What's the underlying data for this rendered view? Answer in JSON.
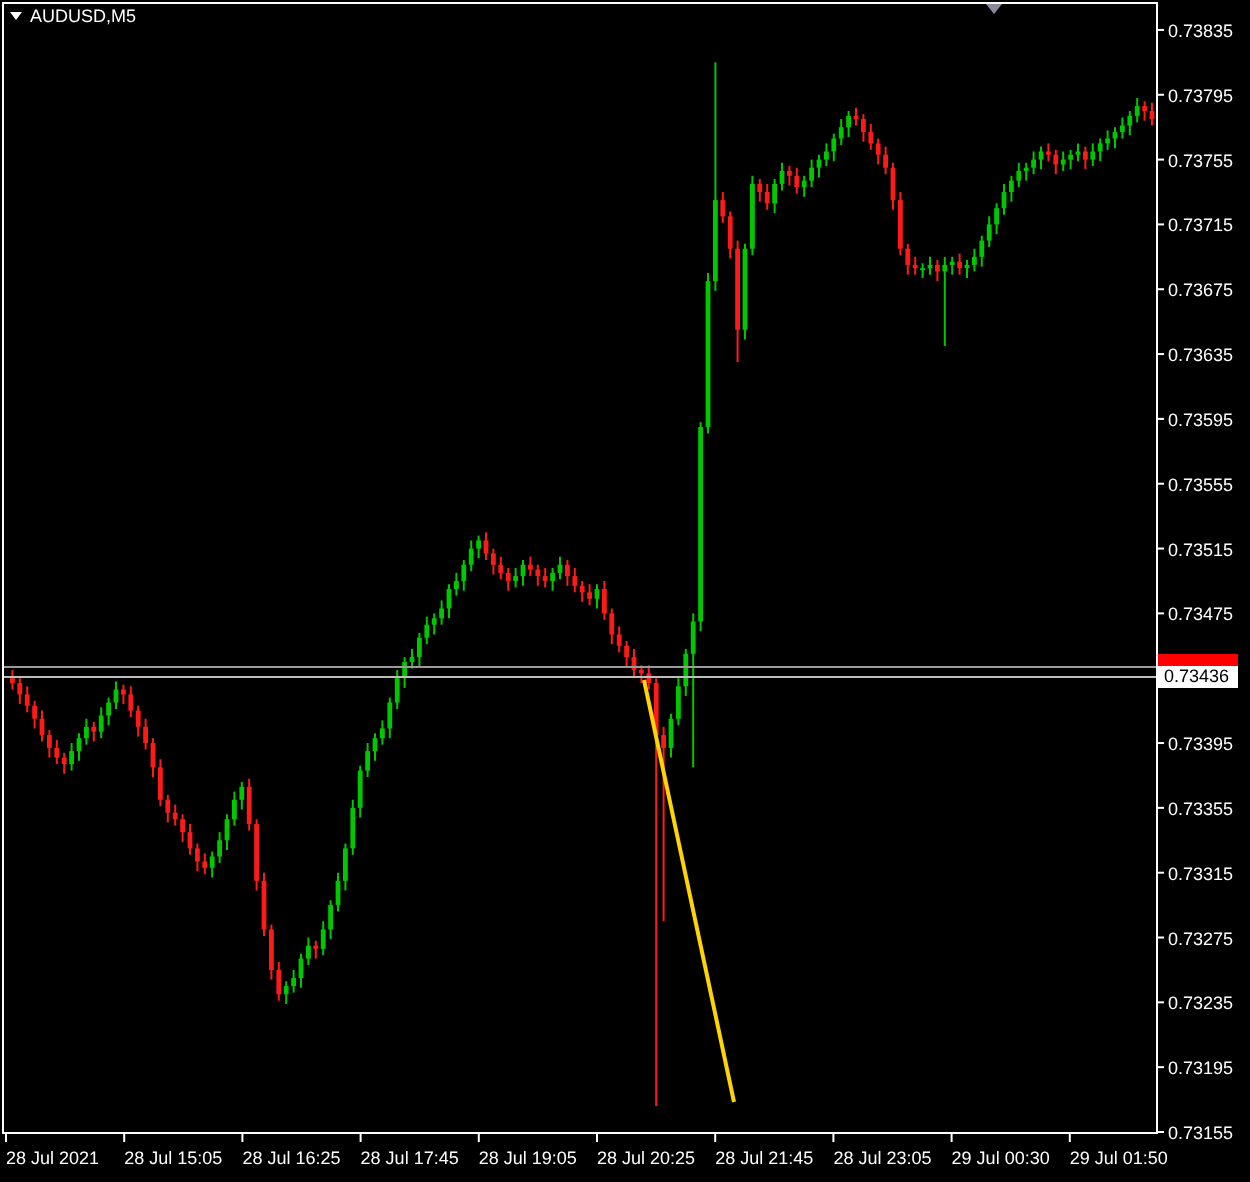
{
  "chart_title": "AUDUSD,M5",
  "chart_data": {
    "type": "candlestick",
    "yticks": [
      {
        "value": 0.73835,
        "label": "0.73835"
      },
      {
        "value": 0.73795,
        "label": "0.73795"
      },
      {
        "value": 0.73755,
        "label": "0.73755"
      },
      {
        "value": 0.73715,
        "label": "0.73715"
      },
      {
        "value": 0.73675,
        "label": "0.73675"
      },
      {
        "value": 0.73635,
        "label": "0.73635"
      },
      {
        "value": 0.73595,
        "label": "0.73595"
      },
      {
        "value": 0.73555,
        "label": "0.73555"
      },
      {
        "value": 0.73515,
        "label": "0.73515"
      },
      {
        "value": 0.73475,
        "label": "0.73475"
      },
      {
        "value": 0.73395,
        "label": "0.73395"
      },
      {
        "value": 0.73355,
        "label": "0.73355"
      },
      {
        "value": 0.73315,
        "label": "0.73315"
      },
      {
        "value": 0.73275,
        "label": "0.73275"
      },
      {
        "value": 0.73235,
        "label": "0.73235"
      },
      {
        "value": 0.73195,
        "label": "0.73195"
      },
      {
        "value": 0.73155,
        "label": "0.73155"
      }
    ],
    "ylim": [
      0.73155,
      0.73851
    ],
    "ref_lines": [
      {
        "axis": "y",
        "value": 0.73443,
        "color": "#9a9a9a"
      },
      {
        "axis": "y",
        "value": 0.73436,
        "color": "#bdbdbd"
      }
    ],
    "ohlc": [
      [
        0.73435,
        0.7344,
        0.73428,
        0.73432
      ],
      [
        0.73432,
        0.73435,
        0.73419,
        0.73425
      ],
      [
        0.73425,
        0.7343,
        0.73414,
        0.73418
      ],
      [
        0.73418,
        0.73421,
        0.73404,
        0.7341
      ],
      [
        0.7341,
        0.73415,
        0.73396,
        0.734
      ],
      [
        0.734,
        0.73403,
        0.73386,
        0.73392
      ],
      [
        0.73392,
        0.73397,
        0.73382,
        0.73386
      ],
      [
        0.73386,
        0.73389,
        0.73376,
        0.73382
      ],
      [
        0.73382,
        0.73395,
        0.73378,
        0.7339
      ],
      [
        0.7339,
        0.73401,
        0.73384,
        0.73398
      ],
      [
        0.73398,
        0.7341,
        0.73394,
        0.73405
      ],
      [
        0.73405,
        0.73408,
        0.73396,
        0.73402
      ],
      [
        0.73402,
        0.73417,
        0.73398,
        0.73412
      ],
      [
        0.73412,
        0.73423,
        0.73406,
        0.7342
      ],
      [
        0.7342,
        0.73433,
        0.73416,
        0.73428
      ],
      [
        0.73428,
        0.73431,
        0.73419,
        0.73425
      ],
      [
        0.73425,
        0.7343,
        0.73411,
        0.73415
      ],
      [
        0.73415,
        0.73418,
        0.73399,
        0.73405
      ],
      [
        0.73405,
        0.7341,
        0.73391,
        0.73395
      ],
      [
        0.73395,
        0.73398,
        0.73374,
        0.7338
      ],
      [
        0.7338,
        0.73385,
        0.73356,
        0.7336
      ],
      [
        0.7336,
        0.73363,
        0.73346,
        0.73352
      ],
      [
        0.73352,
        0.73357,
        0.73344,
        0.73348
      ],
      [
        0.73348,
        0.73351,
        0.73334,
        0.7334
      ],
      [
        0.7334,
        0.73345,
        0.73326,
        0.7333
      ],
      [
        0.7333,
        0.73333,
        0.73316,
        0.73322
      ],
      [
        0.73322,
        0.73327,
        0.73314,
        0.73318
      ],
      [
        0.73318,
        0.73328,
        0.73312,
        0.73325
      ],
      [
        0.73325,
        0.7334,
        0.73321,
        0.73335
      ],
      [
        0.73335,
        0.73351,
        0.73329,
        0.73348
      ],
      [
        0.73348,
        0.73365,
        0.73344,
        0.7336
      ],
      [
        0.7336,
        0.73371,
        0.73354,
        0.73368
      ],
      [
        0.73368,
        0.73373,
        0.73341,
        0.73345
      ],
      [
        0.73345,
        0.73348,
        0.73304,
        0.7331
      ],
      [
        0.7331,
        0.73315,
        0.73276,
        0.7328
      ],
      [
        0.7328,
        0.73283,
        0.73249,
        0.73255
      ],
      [
        0.73255,
        0.7326,
        0.73236,
        0.7324
      ],
      [
        0.7324,
        0.73248,
        0.73234,
        0.73245
      ],
      [
        0.73245,
        0.73255,
        0.73241,
        0.7325
      ],
      [
        0.7325,
        0.73265,
        0.73244,
        0.73262
      ],
      [
        0.73262,
        0.73275,
        0.73258,
        0.7327
      ],
      [
        0.7327,
        0.73273,
        0.73262,
        0.73268
      ],
      [
        0.73268,
        0.73285,
        0.73264,
        0.7328
      ],
      [
        0.7328,
        0.73298,
        0.73274,
        0.73295
      ],
      [
        0.73295,
        0.73315,
        0.73291,
        0.7331
      ],
      [
        0.7331,
        0.73333,
        0.73304,
        0.7333
      ],
      [
        0.7333,
        0.7336,
        0.73326,
        0.73355
      ],
      [
        0.73355,
        0.73381,
        0.73349,
        0.73378
      ],
      [
        0.73378,
        0.73395,
        0.73374,
        0.7339
      ],
      [
        0.7339,
        0.73401,
        0.73384,
        0.73398
      ],
      [
        0.73398,
        0.73409,
        0.73394,
        0.73404
      ],
      [
        0.73404,
        0.73423,
        0.73398,
        0.7342
      ],
      [
        0.7342,
        0.7344,
        0.73416,
        0.73435
      ],
      [
        0.73435,
        0.73448,
        0.73429,
        0.73445
      ],
      [
        0.73445,
        0.73453,
        0.73441,
        0.73448
      ],
      [
        0.73448,
        0.73463,
        0.73442,
        0.7346
      ],
      [
        0.7346,
        0.73473,
        0.73456,
        0.73468
      ],
      [
        0.73468,
        0.73475,
        0.73462,
        0.73472
      ],
      [
        0.73472,
        0.73483,
        0.73468,
        0.73478
      ],
      [
        0.73478,
        0.73493,
        0.73472,
        0.7349
      ],
      [
        0.7349,
        0.735,
        0.73486,
        0.73495
      ],
      [
        0.73495,
        0.73508,
        0.73489,
        0.73505
      ],
      [
        0.73505,
        0.7352,
        0.73501,
        0.73515
      ],
      [
        0.73515,
        0.73523,
        0.73509,
        0.7352
      ],
      [
        0.7352,
        0.73525,
        0.73508,
        0.73512
      ],
      [
        0.73512,
        0.73515,
        0.73499,
        0.73505
      ],
      [
        0.73505,
        0.7351,
        0.73496,
        0.735
      ],
      [
        0.735,
        0.73503,
        0.73489,
        0.73495
      ],
      [
        0.73495,
        0.73503,
        0.73491,
        0.73498
      ],
      [
        0.73498,
        0.73508,
        0.73492,
        0.73505
      ],
      [
        0.73505,
        0.7351,
        0.73498,
        0.73502
      ],
      [
        0.73502,
        0.73505,
        0.73492,
        0.73498
      ],
      [
        0.73498,
        0.73503,
        0.73491,
        0.73495
      ],
      [
        0.73495,
        0.73503,
        0.73489,
        0.735
      ],
      [
        0.735,
        0.7351,
        0.73496,
        0.73505
      ],
      [
        0.73505,
        0.73508,
        0.73492,
        0.73498
      ],
      [
        0.73498,
        0.73503,
        0.73488,
        0.73492
      ],
      [
        0.73492,
        0.73495,
        0.73482,
        0.73488
      ],
      [
        0.73488,
        0.73493,
        0.7348,
        0.73484
      ],
      [
        0.73484,
        0.73493,
        0.73478,
        0.7349
      ],
      [
        0.7349,
        0.73495,
        0.73471,
        0.73475
      ],
      [
        0.73475,
        0.73478,
        0.73456,
        0.73462
      ],
      [
        0.73462,
        0.73467,
        0.73451,
        0.73455
      ],
      [
        0.73455,
        0.73458,
        0.73442,
        0.73448
      ],
      [
        0.73448,
        0.73453,
        0.73436,
        0.7344
      ],
      [
        0.7344,
        0.73443,
        0.73432,
        0.73438
      ],
      [
        0.73438,
        0.73443,
        0.73428,
        0.73432
      ],
      [
        0.73432,
        0.73435,
        0.73171,
        0.734
      ],
      [
        0.734,
        0.73405,
        0.73285,
        0.73392
      ],
      [
        0.73392,
        0.73413,
        0.73386,
        0.7341
      ],
      [
        0.7341,
        0.73435,
        0.73406,
        0.7343
      ],
      [
        0.7343,
        0.73453,
        0.73424,
        0.7345
      ],
      [
        0.7345,
        0.73475,
        0.7338,
        0.7347
      ],
      [
        0.7347,
        0.73593,
        0.73464,
        0.7359
      ],
      [
        0.7359,
        0.73685,
        0.73586,
        0.7368
      ],
      [
        0.7368,
        0.73815,
        0.73674,
        0.7373
      ],
      [
        0.7373,
        0.73735,
        0.73716,
        0.7372
      ],
      [
        0.7372,
        0.73723,
        0.73694,
        0.737
      ],
      [
        0.737,
        0.73705,
        0.7363,
        0.7365
      ],
      [
        0.7365,
        0.73703,
        0.73644,
        0.737
      ],
      [
        0.737,
        0.73745,
        0.73696,
        0.7374
      ],
      [
        0.7374,
        0.73743,
        0.73729,
        0.73735
      ],
      [
        0.73735,
        0.7374,
        0.73724,
        0.73728
      ],
      [
        0.73728,
        0.73743,
        0.73722,
        0.7374
      ],
      [
        0.7374,
        0.73753,
        0.73736,
        0.73748
      ],
      [
        0.73748,
        0.73751,
        0.73739,
        0.73745
      ],
      [
        0.73745,
        0.7375,
        0.73734,
        0.73738
      ],
      [
        0.73738,
        0.73745,
        0.73732,
        0.73742
      ],
      [
        0.73742,
        0.73755,
        0.73738,
        0.7375
      ],
      [
        0.7375,
        0.73758,
        0.73744,
        0.73755
      ],
      [
        0.73755,
        0.73765,
        0.73751,
        0.7376
      ],
      [
        0.7376,
        0.73771,
        0.73754,
        0.73768
      ],
      [
        0.73768,
        0.7378,
        0.73764,
        0.73775
      ],
      [
        0.73775,
        0.73785,
        0.73769,
        0.73782
      ],
      [
        0.73782,
        0.73787,
        0.73776,
        0.7378
      ],
      [
        0.7378,
        0.73783,
        0.73766,
        0.73772
      ],
      [
        0.73772,
        0.73777,
        0.73761,
        0.73765
      ],
      [
        0.73765,
        0.73768,
        0.73752,
        0.73758
      ],
      [
        0.73758,
        0.73763,
        0.73746,
        0.7375
      ],
      [
        0.7375,
        0.73753,
        0.73724,
        0.7373
      ],
      [
        0.7373,
        0.73735,
        0.73696,
        0.737
      ],
      [
        0.737,
        0.73703,
        0.73684,
        0.7369
      ],
      [
        0.7369,
        0.73695,
        0.73684,
        0.73688
      ],
      [
        0.73688,
        0.73691,
        0.73682,
        0.73688
      ],
      [
        0.73688,
        0.73695,
        0.73684,
        0.7369
      ],
      [
        0.7369,
        0.73693,
        0.7368,
        0.73686
      ],
      [
        0.73686,
        0.73695,
        0.7364,
        0.7369
      ],
      [
        0.7369,
        0.73695,
        0.73684,
        0.73692
      ],
      [
        0.73692,
        0.73697,
        0.73684,
        0.73688
      ],
      [
        0.73688,
        0.73693,
        0.73682,
        0.7369
      ],
      [
        0.7369,
        0.737,
        0.73686,
        0.73695
      ],
      [
        0.73695,
        0.73708,
        0.73689,
        0.73705
      ],
      [
        0.73705,
        0.7372,
        0.73701,
        0.73715
      ],
      [
        0.73715,
        0.73728,
        0.73709,
        0.73725
      ],
      [
        0.73725,
        0.7374,
        0.73721,
        0.73735
      ],
      [
        0.73735,
        0.73745,
        0.73729,
        0.73742
      ],
      [
        0.73742,
        0.73753,
        0.73738,
        0.73748
      ],
      [
        0.73748,
        0.73753,
        0.73742,
        0.7375
      ],
      [
        0.7375,
        0.7376,
        0.73746,
        0.73755
      ],
      [
        0.73755,
        0.73763,
        0.73749,
        0.7376
      ],
      [
        0.7376,
        0.73765,
        0.73754,
        0.73758
      ],
      [
        0.73758,
        0.73761,
        0.73746,
        0.73752
      ],
      [
        0.73752,
        0.7376,
        0.73748,
        0.73755
      ],
      [
        0.73755,
        0.73761,
        0.73749,
        0.73758
      ],
      [
        0.73758,
        0.73765,
        0.73754,
        0.7376
      ],
      [
        0.7376,
        0.73763,
        0.73749,
        0.73755
      ],
      [
        0.73755,
        0.73765,
        0.73751,
        0.7376
      ],
      [
        0.7376,
        0.73768,
        0.73754,
        0.73765
      ],
      [
        0.73765,
        0.73773,
        0.73761,
        0.73768
      ],
      [
        0.73768,
        0.73775,
        0.73762,
        0.73772
      ],
      [
        0.73772,
        0.73781,
        0.73768,
        0.73776
      ],
      [
        0.73776,
        0.73785,
        0.7377,
        0.73782
      ],
      [
        0.73782,
        0.73793,
        0.73778,
        0.73788
      ],
      [
        0.73788,
        0.73791,
        0.73779,
        0.73785
      ],
      [
        0.73785,
        0.7379,
        0.73776,
        0.7378
      ]
    ]
  },
  "current_price": "0.73436",
  "time_axis": [
    "28 Jul 2021",
    "28 Jul 15:05",
    "28 Jul 16:25",
    "28 Jul 17:45",
    "28 Jul 19:05",
    "28 Jul 20:25",
    "28 Jul 21:45",
    "28 Jul 23:05",
    "29 Jul 00:30",
    "29 Jul 01:50"
  ]
}
